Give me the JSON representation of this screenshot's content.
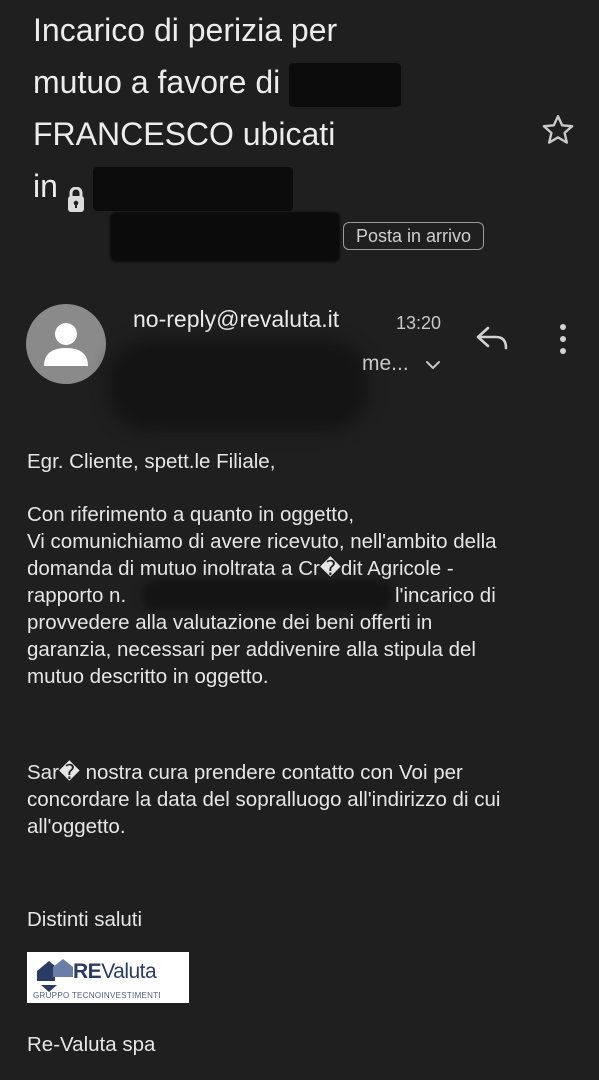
{
  "email": {
    "subject_lines": [
      "Incarico di perizia per",
      "mutuo a favore di",
      "FRANCESCO ubicati",
      "in"
    ],
    "label": "Posta in arrivo",
    "sender": "no-reply@revaluta.it",
    "time": "13:20",
    "recipient_truncated": "me...",
    "body": {
      "greeting": "Egr. Cliente, spett.le Filiale,",
      "paragraph1": [
        "Con riferimento a quanto in oggetto,",
        "Vi comunichiamo di avere ricevuto, nell'ambito della",
        "domanda di mutuo inoltrata a Cr�dit Agricole -",
        "rapporto n.",
        "l'incarico di",
        "provvedere alla valutazione dei beni offerti in",
        "garanzia, necessari per addivenire alla stipula del",
        "mutuo descritto in oggetto."
      ],
      "paragraph2": [
        "Sar� nostra cura prendere contatto con Voi per",
        "concordare la data del sopralluogo all'indirizzo di cui",
        "all'oggetto."
      ],
      "closing": "Distinti saluti",
      "signature": "Re-Valuta spa"
    },
    "logo": {
      "name_bold": "RE",
      "name_light": "Valuta",
      "tagline": "GRUPPO TECNOINVESTIMENTI"
    }
  },
  "icons": {
    "star": "star-outline-icon",
    "reply": "reply-icon",
    "more": "more-vert-icon",
    "expand": "chevron-down-icon",
    "avatar": "person-icon"
  },
  "colors": {
    "background": "#1f1f1f",
    "text": "#e6e6e6",
    "avatar": "#8a8a8a",
    "logo_brand": "#2a3b66"
  }
}
